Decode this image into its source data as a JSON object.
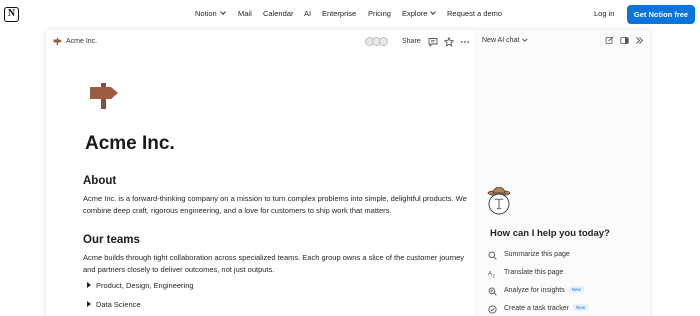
{
  "site_nav": {
    "logo": "N",
    "items": [
      {
        "label": "Notion",
        "dropdown": true
      },
      {
        "label": "Mail",
        "dropdown": false
      },
      {
        "label": "Calendar",
        "dropdown": false
      },
      {
        "label": "AI",
        "dropdown": false
      },
      {
        "label": "Enterprise",
        "dropdown": false
      },
      {
        "label": "Pricing",
        "dropdown": false
      },
      {
        "label": "Explore",
        "dropdown": true
      },
      {
        "label": "Request a demo",
        "dropdown": false
      }
    ],
    "login": "Log in",
    "cta": "Get Notion free",
    "cta_color": "#0a74da"
  },
  "doc_bar": {
    "breadcrumb": "Acme Inc.",
    "share": "Share",
    "icons": [
      "comment-icon",
      "star-icon",
      "more-icon"
    ]
  },
  "doc": {
    "title": "Acme Inc.",
    "icon": "signpost-icon",
    "icon_color": "#9c5b43",
    "about_heading": "About",
    "about_text": "Acme Inc. is a forward-thinking company on a mission to turn complex problems into simple, delightful products. We combine deep craft, rigorous engineering, and a love for customers to ship work that matters.",
    "teams_heading": "Our teams",
    "teams_text": "Acme builds through tight collaboration across specialized teams. Each group owns a slice of the customer journey and partners closely to deliver outcomes, not just outputs.",
    "toggles": [
      "Product, Design, Engineering",
      "Data Science"
    ]
  },
  "ai_panel": {
    "header": "New AI chat",
    "icons": [
      "new-chat-icon",
      "sidebar-icon",
      "collapse-icon"
    ],
    "question": "How can I help you today?",
    "options": [
      {
        "label": "Summarize this page",
        "icon": "search-icon",
        "badge": ""
      },
      {
        "label": "Translate this page",
        "icon": "translate-icon",
        "badge": ""
      },
      {
        "label": "Analyze for insights",
        "icon": "zoom-icon",
        "badge": "New"
      },
      {
        "label": "Create a task tracker",
        "icon": "check-circle-icon",
        "badge": "New"
      }
    ]
  }
}
